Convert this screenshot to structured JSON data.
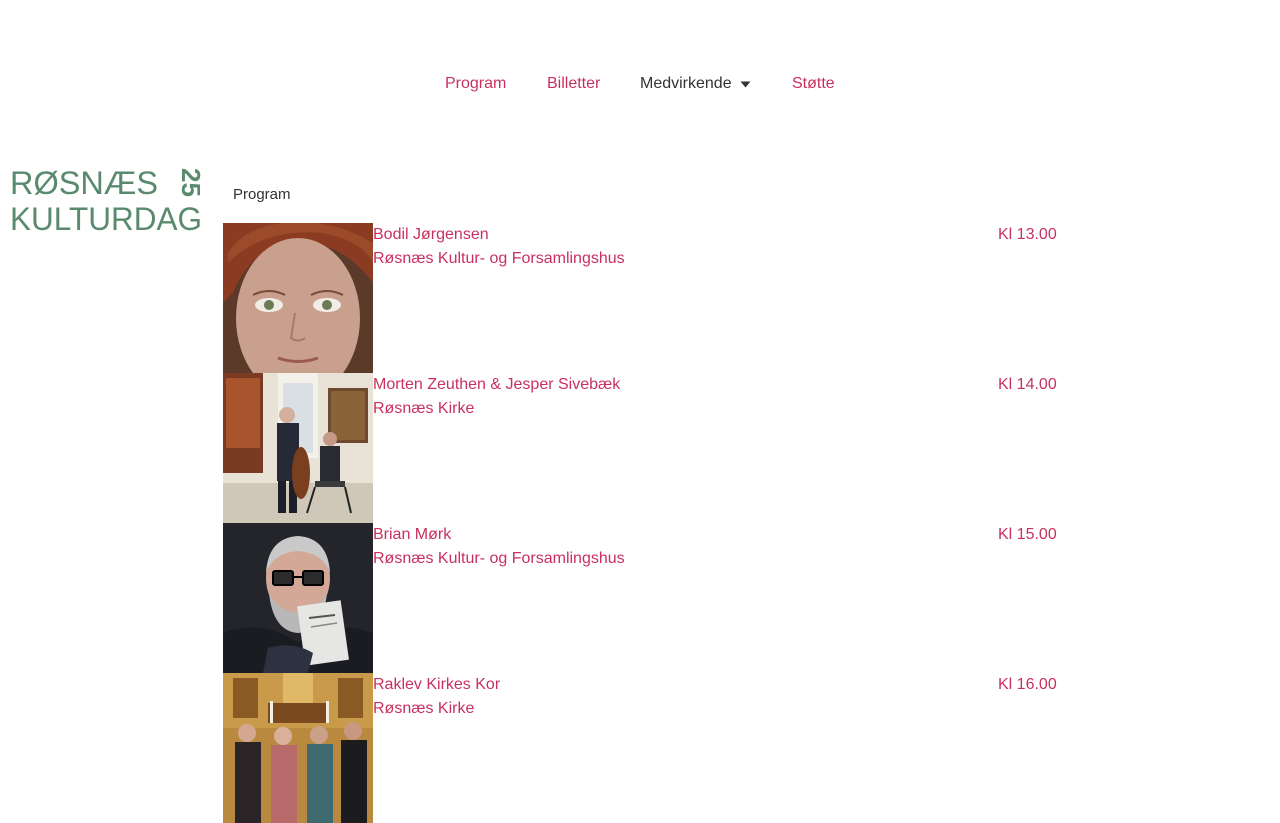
{
  "brand": {
    "logo_line1": "RØSNÆS",
    "logo_line2": "KULTURDAG",
    "logo_year": "25",
    "logo_color": "#5a8a6e"
  },
  "nav": {
    "items": [
      {
        "label": "Program"
      },
      {
        "label": "Billetter"
      },
      {
        "label": "Medvirkende",
        "icon": "caret-down-icon"
      },
      {
        "label": "Støtte"
      }
    ]
  },
  "colors": {
    "accent": "#c8315f",
    "text": "#333333"
  },
  "program": {
    "heading": "Program",
    "events": [
      {
        "name": "Bodil Jørgensen",
        "venue": "Røsnæs Kultur- og Forsamlingshus",
        "time": "Kl 13.00",
        "image": "portrait-photo"
      },
      {
        "name": "Morten Zeuthen & Jesper Sivebæk",
        "venue": "Røsnæs Kirke",
        "time": "Kl 14.00",
        "image": "musicians-photo"
      },
      {
        "name": "Brian Mørk",
        "venue": "Røsnæs Kultur- og Forsamlingshus",
        "time": "Kl 15.00",
        "image": "portrait-photo"
      },
      {
        "name": "Raklev Kirkes Kor",
        "venue": "Røsnæs Kirke",
        "time": "Kl 16.00",
        "image": "choir-photo"
      }
    ]
  }
}
